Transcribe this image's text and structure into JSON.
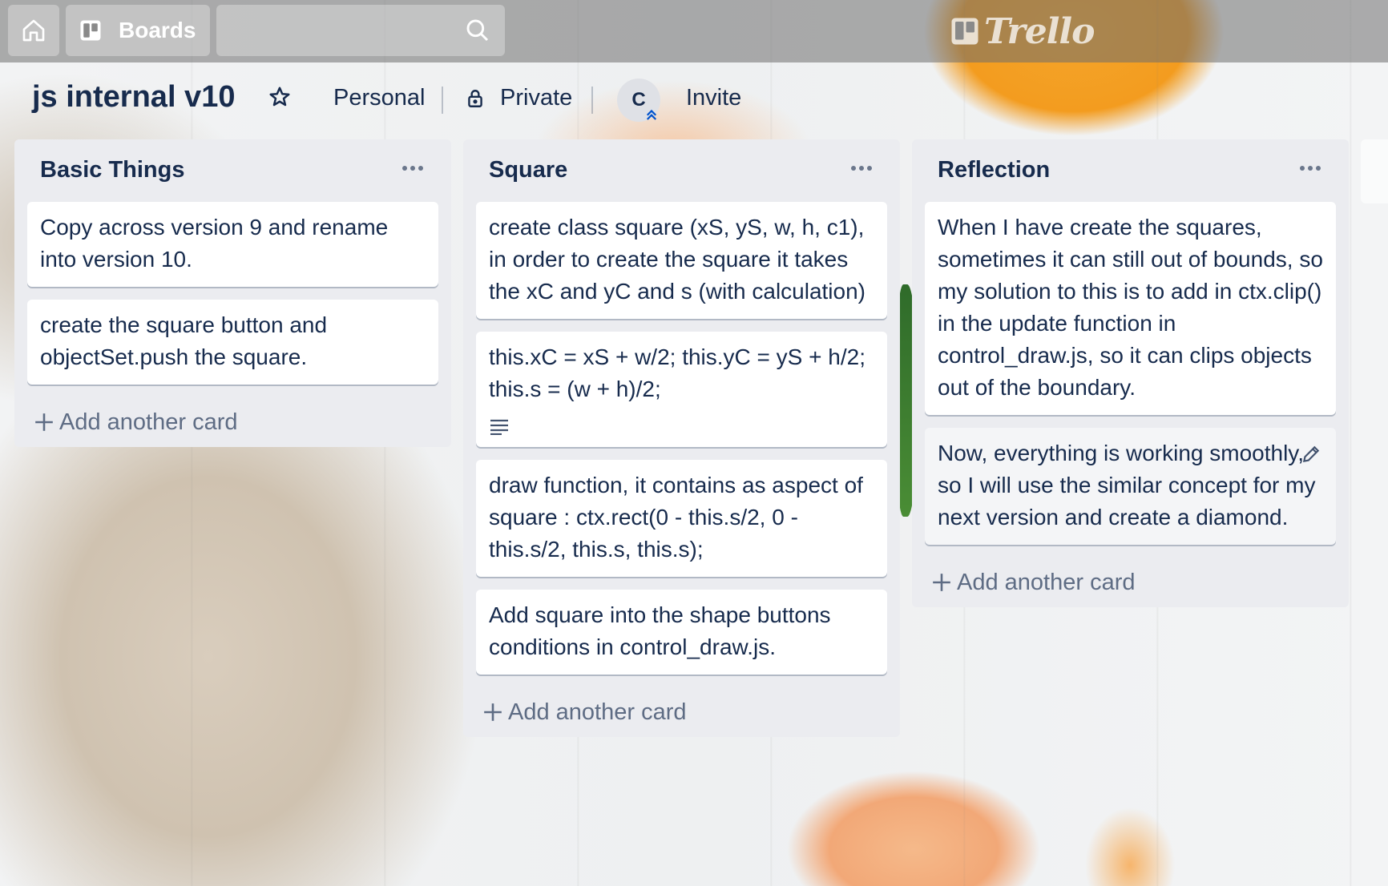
{
  "header": {
    "home_icon": "home-icon",
    "boards_label": "Boards",
    "search_icon": "search-icon",
    "search_value": "",
    "logo_text": "Trello"
  },
  "board": {
    "title": "js internal v10",
    "visibility_team": "Personal",
    "visibility": "Private",
    "member_initial": "C",
    "invite_label": "Invite"
  },
  "lists": [
    {
      "title": "Basic Things",
      "cards": [
        "Copy across version 9 and rename into version 10.",
        "create the square button and objectSet.push the square."
      ],
      "add_label": "Add another card"
    },
    {
      "title": "Square",
      "cards": [
        "create class square (xS, yS, w, h, c1), in order to create the square it takes the xC and yC and s (with calculation)",
        "this.xC = xS + w/2; this.yC = yS + h/2; this.s = (w + h)/2;",
        "draw function, it contains as aspect of square : ctx.rect(0 - this.s/2, 0 - this.s/2, this.s, this.s);",
        "Add square into the shape buttons conditions in control_draw.js."
      ],
      "add_label": "Add another card"
    },
    {
      "title": "Reflection",
      "cards": [
        "When I have create the squares, sometimes it can still out of bounds, so my solution to this is to add in ctx.clip() in the update function in control_draw.js, so it can clips objects out of the boundary.",
        "Now, everything is working smoothly, so I will use the similar concept for my next version and create a diamond."
      ],
      "add_label": "Add another card"
    }
  ],
  "colors": {
    "header_bg": "#6e6e6e",
    "list_bg": "#ebecf0",
    "card_bg": "#ffffff",
    "text": "#172b4d",
    "muted": "#5e6c84"
  }
}
